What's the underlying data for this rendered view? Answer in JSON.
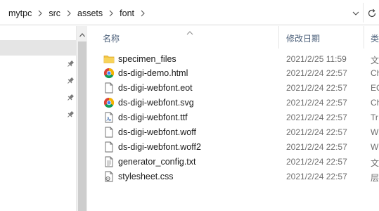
{
  "address_bar": {
    "breadcrumbs": [
      "mytpc",
      "src",
      "assets",
      "font"
    ],
    "separator_icon": "chevron-right-icon",
    "dropdown_icon": "chevron-down-icon",
    "refresh_icon": "refresh-icon"
  },
  "nav_pane": {
    "pinned_icons": [
      "pin-icon",
      "pin-icon",
      "pin-icon",
      "pin-icon"
    ]
  },
  "file_list": {
    "columns": {
      "name": "名称",
      "modified": "修改日期",
      "type": "类"
    },
    "sorted_by": "name",
    "files": [
      {
        "name": "specimen_files",
        "date": "2021/2/25 11:59",
        "type": "文",
        "icon": "folder-icon"
      },
      {
        "name": "ds-digi-demo.html",
        "date": "2021/2/24 22:57",
        "type": "Ch",
        "icon": "chrome-icon"
      },
      {
        "name": "ds-digi-webfont.eot",
        "date": "2021/2/24 22:57",
        "type": "EC",
        "icon": "file-icon"
      },
      {
        "name": "ds-digi-webfont.svg",
        "date": "2021/2/24 22:57",
        "type": "Ch",
        "icon": "chrome-icon"
      },
      {
        "name": "ds-digi-webfont.ttf",
        "date": "2021/2/24 22:57",
        "type": "Tr",
        "icon": "font-file-icon"
      },
      {
        "name": "ds-digi-webfont.woff",
        "date": "2021/2/24 22:57",
        "type": "W",
        "icon": "file-icon"
      },
      {
        "name": "ds-digi-webfont.woff2",
        "date": "2021/2/24 22:57",
        "type": "W",
        "icon": "file-icon"
      },
      {
        "name": "generator_config.txt",
        "date": "2021/2/24 22:57",
        "type": "文",
        "icon": "text-file-icon"
      },
      {
        "name": "stylesheet.css",
        "date": "2021/2/24 22:57",
        "type": "层",
        "icon": "css-file-icon"
      }
    ]
  },
  "colors": {
    "header_text": "#4c607a",
    "date_text": "#6d6d6d",
    "folder_yellow": "#f3c340",
    "selected_bg": "#e5e5e5"
  }
}
